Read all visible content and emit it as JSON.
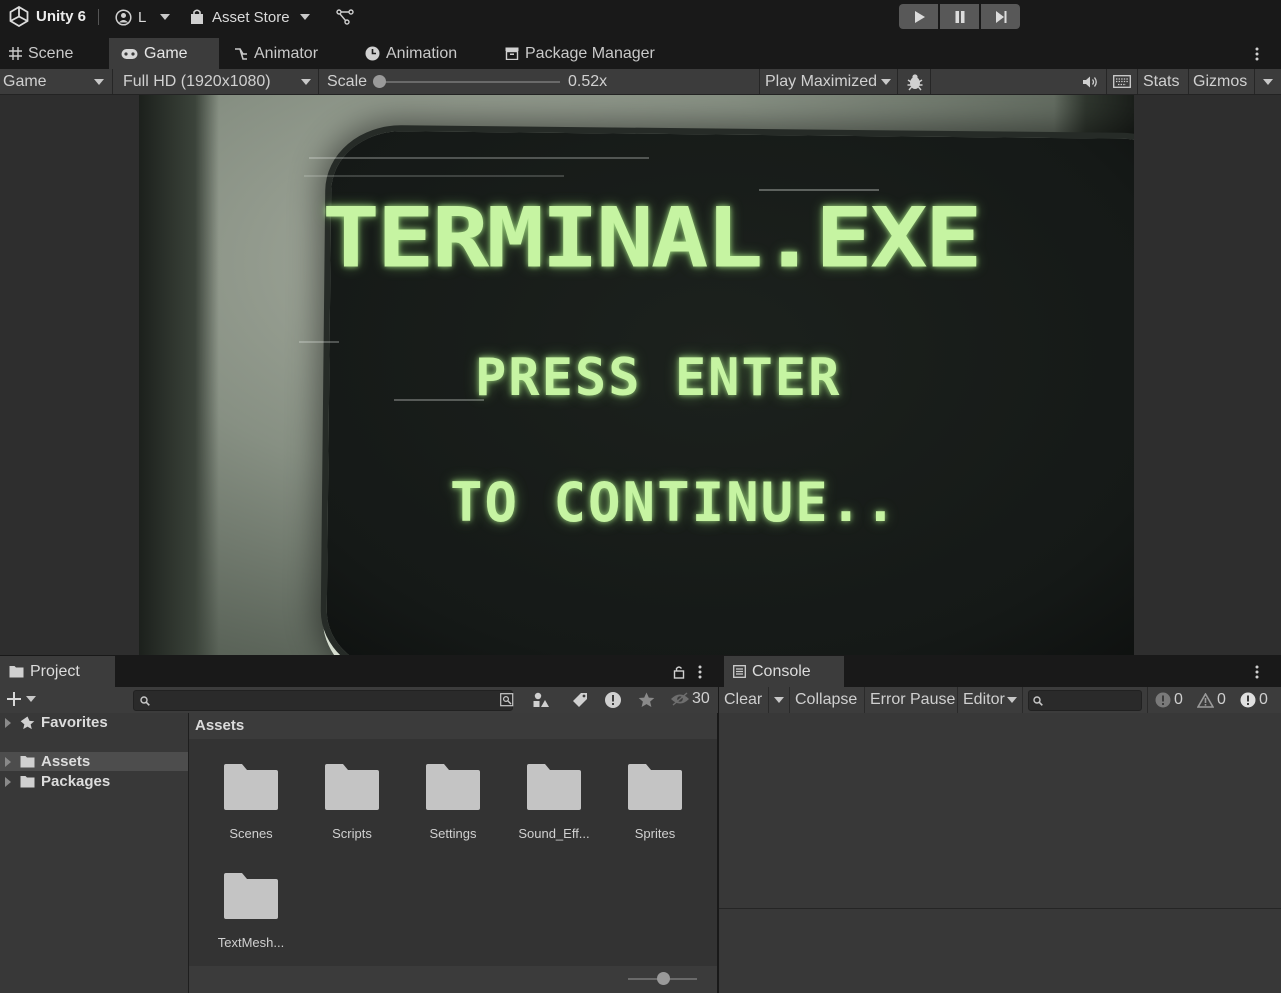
{
  "topbar": {
    "app_name": "Unity 6",
    "account_label": "L",
    "asset_store_label": "Asset Store"
  },
  "tabs": [
    {
      "label": "Scene",
      "icon": "grid-icon"
    },
    {
      "label": "Game",
      "icon": "gamepad-icon",
      "active": true
    },
    {
      "label": "Animator",
      "icon": "animator-icon"
    },
    {
      "label": "Animation",
      "icon": "clock-icon"
    },
    {
      "label": "Package Manager",
      "icon": "package-icon"
    }
  ],
  "game_toolbar": {
    "display": "Game",
    "resolution": "Full HD (1920x1080)",
    "scale_label": "Scale",
    "scale_value": "0.52x",
    "scale_fraction": 0.0,
    "play_mode": "Play Maximized",
    "stats_label": "Stats",
    "gizmos_label": "Gizmos"
  },
  "game_screen": {
    "title": "TERMINAL.EXE",
    "line2": "PRESS ENTER",
    "line3": "TO CONTINUE..",
    "text_color": "#c6f4a2"
  },
  "project": {
    "tab_label": "Project",
    "hidden_count": "30",
    "tree": {
      "favorites": "Favorites",
      "assets": "Assets",
      "packages": "Packages"
    },
    "breadcrumb": "Assets",
    "folders": [
      "Scenes",
      "Scripts",
      "Settings",
      "Sound_Eff...",
      "Sprites",
      "TextMesh..."
    ],
    "zoom_fraction": 0.5
  },
  "console": {
    "tab_label": "Console",
    "clear_label": "Clear",
    "collapse_label": "Collapse",
    "error_pause_label": "Error Pause",
    "editor_label": "Editor",
    "info_count": "0",
    "warning_count": "0",
    "error_count": "0"
  },
  "colors": {
    "panel": "#383838",
    "toolbar": "#3c3c3c",
    "background": "#191919",
    "folder": "#c4c4c4"
  }
}
